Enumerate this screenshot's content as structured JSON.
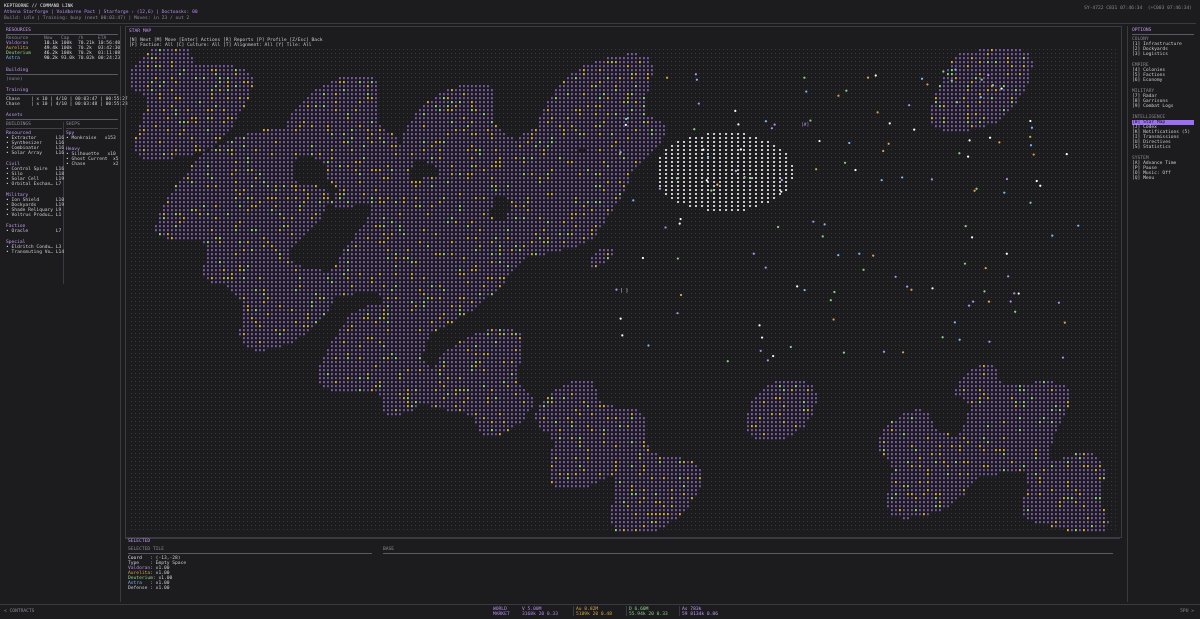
{
  "header": {
    "line1": "KEPTBORNE // COMMAND LINK",
    "line2": "Athena Starforge | Voidborne Pact | Starforge › (12,6) | Doctoasks: 00",
    "line3": "Build: idle | Training: busy (next 00:03:47) | Moves: in 23 / out 2",
    "clock": "SY-4722 C831 07:46:34  (+C003 07:46:34)"
  },
  "resources": {
    "title": "RESOURCES",
    "columns": [
      "Resource",
      "Now",
      "Cap",
      "/h",
      "ETA"
    ],
    "rows": [
      {
        "name": "Valdoran",
        "now": "10.1k",
        "cap": "100k",
        "rate": "70.21k",
        "eta": "10:56:40"
      },
      {
        "name": "Aurelita",
        "now": "49.4k",
        "cap": "100k",
        "rate": "70.2k",
        "eta": "03:42:30"
      },
      {
        "name": "Deuterium",
        "now": "46.2k",
        "cap": "100k",
        "rate": "70.2k",
        "eta": "01:11:08"
      },
      {
        "name": "Astra",
        "now": "90.2k",
        "cap": "93.0k",
        "rate": "70.02k",
        "eta": "00:24:23"
      }
    ]
  },
  "building": {
    "title": "Building",
    "value": "(none)"
  },
  "training": {
    "title": "Training",
    "rows": [
      "Chase    | x 10 | 4/10 | 00:03:47 | 00:55:27",
      "Chase    | x 10 | 4/10 | 00:03:48 | 00:55:28"
    ]
  },
  "assets": {
    "title": "Assets",
    "buildings_title": "BUILDINGS",
    "ships_title": "SHIPS",
    "building_groups": [
      {
        "name": "Resourced",
        "items": [
          "• Extractor       L16",
          "• Synthesizer     L16",
          "• Combinator      L16",
          "• Solar Array     L16"
        ]
      },
      {
        "name": "Civil",
        "items": [
          "• Control Spire   L16",
          "• Silo            L18",
          "• Solar Cell      L19",
          "• Orbital Exchan… L7"
        ]
      },
      {
        "name": "Military",
        "items": [
          "• Ion Shield      L10",
          "• Dockyards       L19",
          "• Shade Reliquary L9",
          "• Voltrus Produc… L1"
        ]
      },
      {
        "name": "Faction",
        "items": [
          "• Oracle          L7"
        ]
      },
      {
        "name": "Special",
        "items": [
          "• Eldritch Condu… L3",
          "• Transmuting Vo… L14"
        ]
      }
    ],
    "ship_groups": [
      {
        "name": "Spy",
        "items": [
          "• Monkraise   x153"
        ]
      },
      {
        "name": "Heavy",
        "items": [
          "• Silhouette   x10",
          "• Ghost Current  x5",
          "• Chase          x2"
        ]
      }
    ]
  },
  "map": {
    "title": "STAR MAP",
    "keys1": "[N] Next [M] Move [Enter] Actions [R] Reports [P] Profile [Z/Esc] Back",
    "keys2": "[F] Faction: All [C] Culture: All [T] Alignment: All [Y] Tile: All",
    "cursor": "[ ]",
    "marker": "[#]"
  },
  "selected": {
    "title": "SELECTED",
    "tile_title": "SELECTED TILE",
    "base_title": "BASE",
    "rows": [
      {
        "label": "Coord   ",
        "value": ": (-13,-28)"
      },
      {
        "label": "Type    ",
        "value": ": Empty Space"
      },
      {
        "label": "Valdoran",
        "value": ": x1.00"
      },
      {
        "label": "Aurelita",
        "value": ": x1.00"
      },
      {
        "label": "Deuterium",
        "value": ": x1.00"
      },
      {
        "label": "Astra   ",
        "value": ": x1.00"
      },
      {
        "label": "Defense ",
        "value": ": x1.00"
      }
    ]
  },
  "options": {
    "title": "OPTIONS",
    "groups": [
      {
        "name": "COLONY",
        "items": [
          "[1] Infrastructure",
          "[2] Dockyards",
          "[3] Logistics"
        ]
      },
      {
        "name": "EMPIRE",
        "items": [
          "[4] Colonies",
          "[5] Factions",
          "[6] Economy"
        ]
      },
      {
        "name": "MILITARY",
        "items": [
          "[7] Radar",
          "[8] Garrisons",
          "[9] Combat Logs"
        ]
      },
      {
        "name": "INTELLIGENCE",
        "items": [
          "[0] Star Map",
          "[J] Codex",
          "[K] Notifications (5)",
          "[I] Transmissions",
          "[U] Directives",
          "[S] Statistics"
        ]
      },
      {
        "name": "SYSTEM",
        "items": [
          "[A] Advance Time",
          "[P] Pause",
          "[O] Music: Off",
          "[Q] Menu"
        ]
      }
    ],
    "active": "[0] Star Map"
  },
  "bottom": {
    "contracts": "< CONTRACTS",
    "world_market_1": "WORLD",
    "world_market_2": "MARKET",
    "markets": [
      {
        "top": "V 5.00M",
        "bot": "3168k 20 0.33",
        "color": "#b98cf0"
      },
      {
        "top": "Au 8.82M",
        "bot": "5189k 20 0.48",
        "color": "#d7a64a"
      },
      {
        "top": "D 6.60M",
        "bot": "55.94k 20 0.33",
        "color": "#8fd18c"
      },
      {
        "top": "As 783k",
        "bot": "59 8134k 0.86",
        "color": "#c39cf5"
      }
    ],
    "sp": "5PU >"
  },
  "colors": {
    "bg": "#1c1c1e",
    "accent": "#9a6ff0",
    "valdoran": "#b98cf0",
    "aurelita": "#d7a64a",
    "deuterium": "#8fd18c",
    "astra": "#7fb6ff"
  }
}
